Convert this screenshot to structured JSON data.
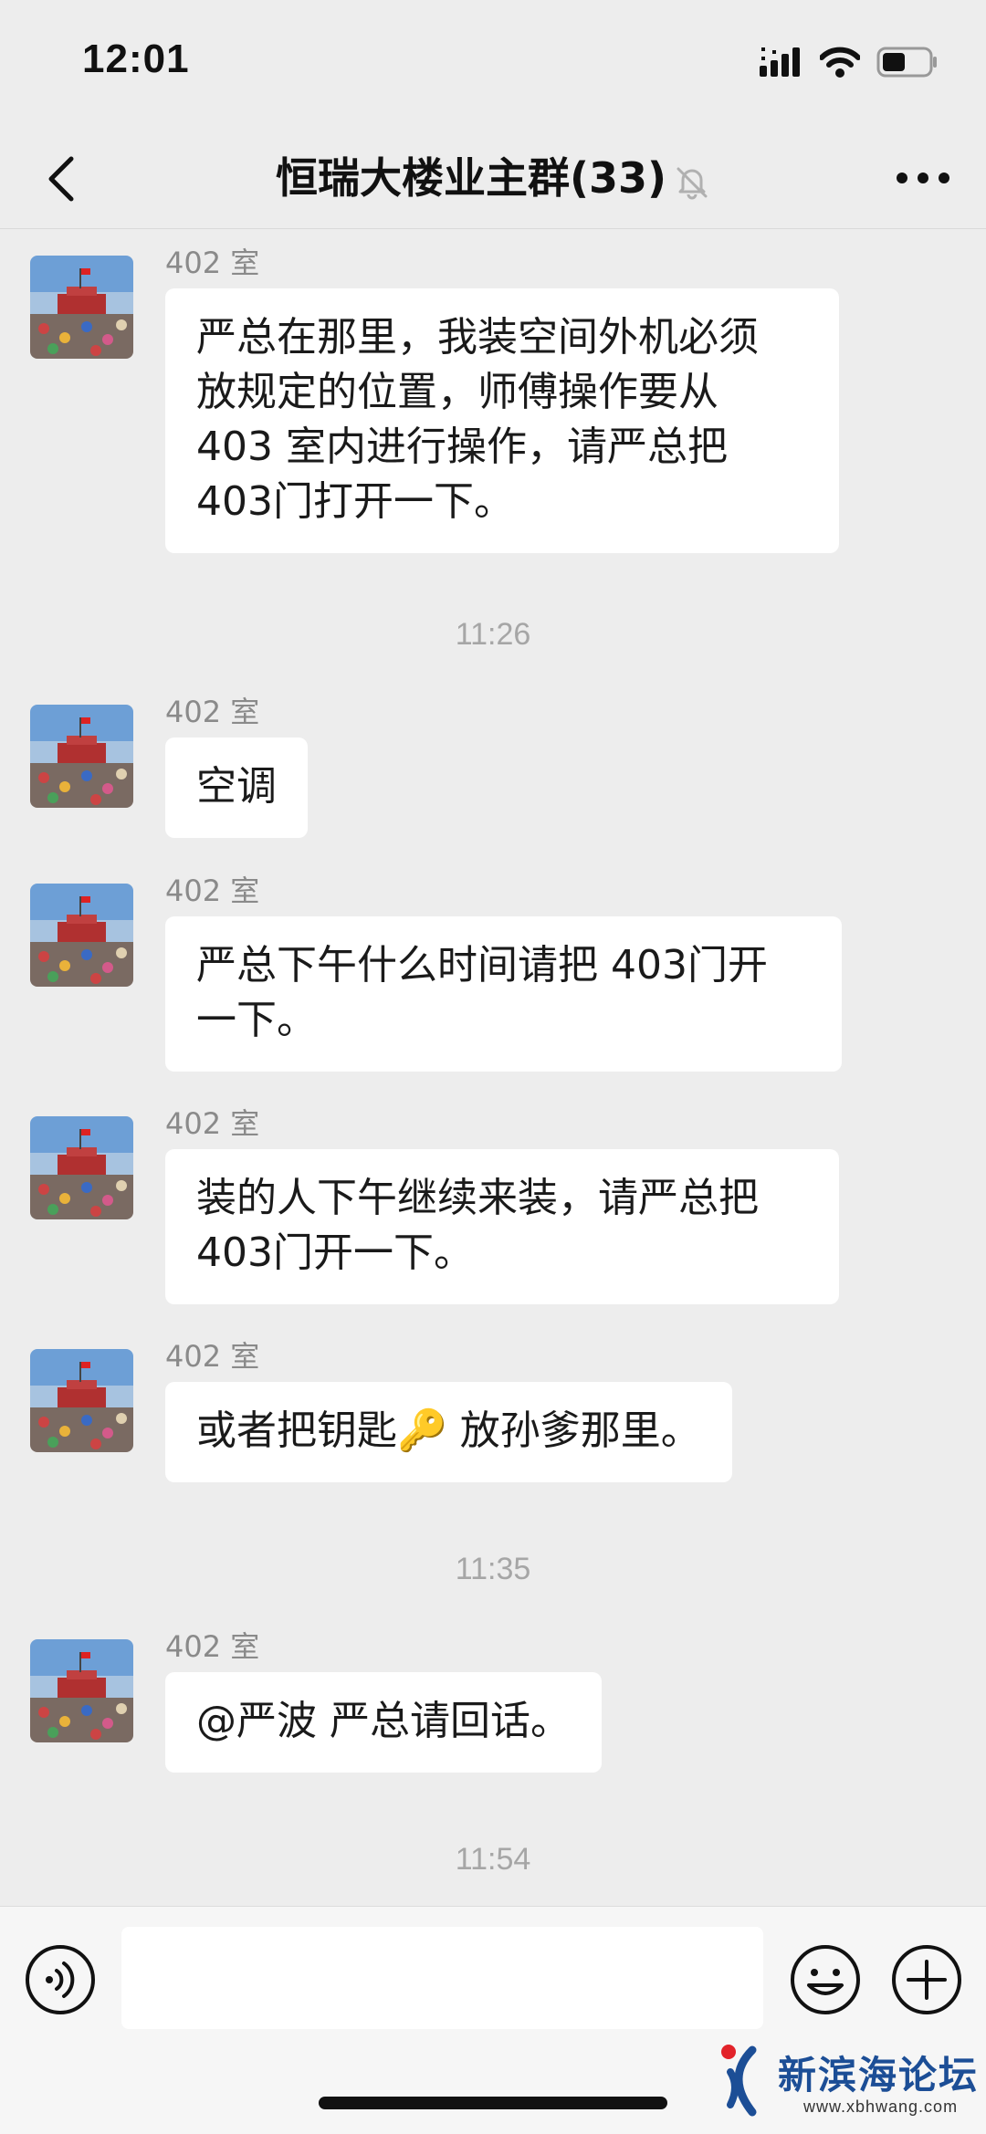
{
  "status_bar": {
    "time": "12:01",
    "icons": [
      "signal-icon",
      "wifi-icon",
      "battery-icon"
    ]
  },
  "nav": {
    "title": "恒瑞大楼业主群(33)",
    "back_icon": "chevron-left-icon",
    "mute_icon": "bell-off-icon",
    "more_icon": "ellipsis-icon"
  },
  "messages": [
    {
      "type": "message",
      "sender": "402 室",
      "text": "严总在那里，我装空间外机必须\n放规定的位置，师傅操作要从\n403 室内进行操作，请严总把\n403门打开一下。"
    },
    {
      "type": "time",
      "text": "11:26"
    },
    {
      "type": "message",
      "sender": "402 室",
      "text": "空调"
    },
    {
      "type": "message",
      "sender": "402 室",
      "text": "严总下午什么时间请把 403门开\n一下。"
    },
    {
      "type": "message",
      "sender": "402 室",
      "text": "装的人下午继续来装，请严总把\n403门开一下。"
    },
    {
      "type": "message",
      "sender": "402 室",
      "text": "或者把钥匙🔑 放孙爹那里。"
    },
    {
      "type": "time",
      "text": "11:35"
    },
    {
      "type": "message",
      "sender": "402 室",
      "text": "@严波 严总请回话。"
    },
    {
      "type": "time",
      "text": "11:54"
    }
  ],
  "input_bar": {
    "value": "",
    "placeholder": "",
    "voice_icon": "voice-icon",
    "emoji_icon": "emoji-icon",
    "plus_icon": "plus-icon"
  },
  "watermark": {
    "name": "新滨海论坛",
    "url": "www.xbhwang.com"
  },
  "colors": {
    "background": "#ededed",
    "bubble": "#ffffff",
    "sender": "#8a8a8a",
    "timestamp": "#a6a6a6",
    "watermark_blue": "#1c4e96",
    "watermark_red": "#e2232a"
  }
}
